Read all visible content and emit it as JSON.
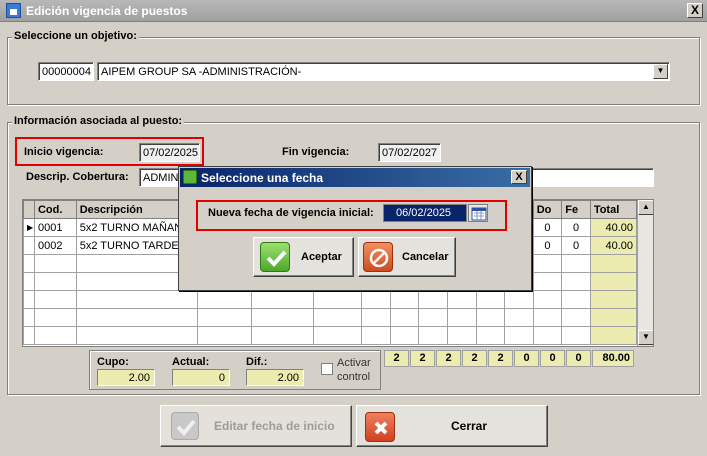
{
  "window": {
    "title": "Edición vigencia de puestos",
    "close": "X"
  },
  "objective": {
    "label": "Seleccione un objetivo:",
    "code": "00000004",
    "name": "AIPEM GROUP SA -ADMINISTRACIÓN-"
  },
  "info": {
    "label": "Información asociada al puesto:",
    "inicio_label": "Inicio vigencia:",
    "inicio_value": "07/02/2025",
    "fin_label": "Fin vigencia:",
    "fin_value": "07/02/2027",
    "descrip_label": "Descrip. Cobertura:",
    "descrip_value": "ADMINI"
  },
  "grid": {
    "headers": {
      "cod": "Cod.",
      "desc": "Descripción",
      "do": "Do",
      "fe": "Fe",
      "total": "Total"
    },
    "rows": [
      {
        "cod": "0001",
        "desc": "5x2 TURNO MAÑANA",
        "do": "0",
        "fe": "0",
        "total": "40.00"
      },
      {
        "cod": "0002",
        "desc": "5x2 TURNO TARDE",
        "do": "0",
        "fe": "0",
        "total": "40.00"
      }
    ],
    "totals": [
      "2",
      "2",
      "2",
      "2",
      "2",
      "0",
      "0",
      "0",
      "80.00"
    ]
  },
  "summary": {
    "cupo_label": "Cupo:",
    "cupo_value": "2.00",
    "actual_label": "Actual:",
    "actual_value": "0",
    "dif_label": "Dif.:",
    "dif_value": "2.00",
    "activar_label_1": "Activar",
    "activar_label_2": "control"
  },
  "buttons": {
    "editar": "Editar fecha de inicio",
    "cerrar": "Cerrar"
  },
  "dialog": {
    "title": "Seleccione una fecha",
    "close": "X",
    "date_label": "Nueva fecha de vigencia inicial:",
    "date_value": "06/02/2025",
    "ok": "Aceptar",
    "cancel": "Cancelar"
  },
  "colors": {
    "highlight": "#e00000",
    "total_bg": "#ecebb0",
    "dialog_title": "#0a246a"
  }
}
